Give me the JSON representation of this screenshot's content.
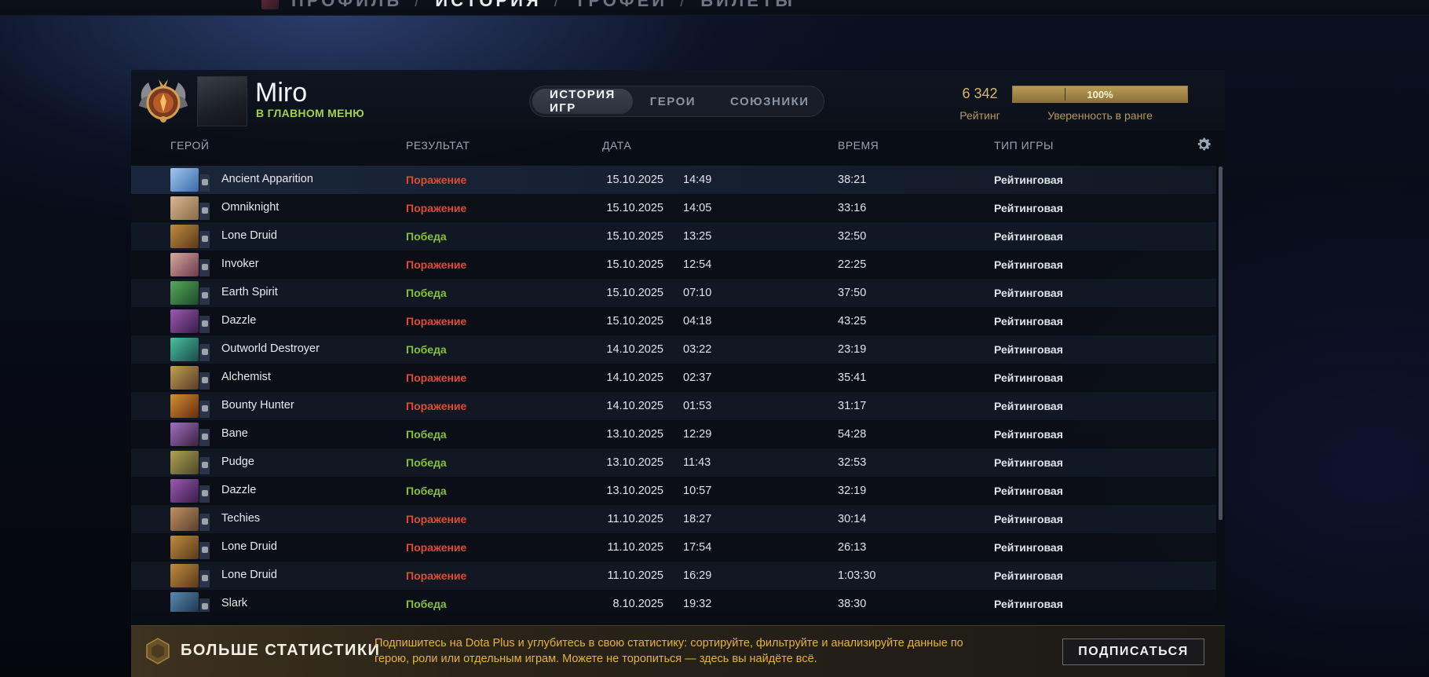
{
  "nav": {
    "items": [
      "ПРОФИЛЬ",
      "ИСТОРИЯ",
      "ТРОФЕИ",
      "БИЛЕТЫ"
    ],
    "separator": "/"
  },
  "player": {
    "name": "Miro",
    "status": "В ГЛАВНОМ МЕНЮ"
  },
  "tabs": [
    "ИСТОРИЯ ИГР",
    "ГЕРОИ",
    "СОЮЗНИКИ"
  ],
  "rating": {
    "value": "6 342",
    "label": "Рейтинг",
    "confidence_text": "100%",
    "confidence_fraction": 1.0,
    "confidence_label": "Уверенность в ранге"
  },
  "columns": {
    "hero": "ГЕРОЙ",
    "result": "РЕЗУЛЬТАТ",
    "date": "ДАТА",
    "duration": "ВРЕМЯ",
    "mode": "ТИП ИГРЫ"
  },
  "colors": {
    "loss": "#e04a35",
    "win": "#89bf3a",
    "status": "#a6d04a",
    "gold": "#d9b66a"
  },
  "matches": [
    {
      "hero": "Ancient Apparition",
      "result": "Поражение",
      "outcome": "loss",
      "date": "15.10.2025",
      "time": "14:49",
      "duration": "38:21",
      "mode": "Рейтинговая",
      "c1": "#9fc8f0",
      "c2": "#3a6aa8"
    },
    {
      "hero": "Omniknight",
      "result": "Поражение",
      "outcome": "loss",
      "date": "15.10.2025",
      "time": "14:05",
      "duration": "33:16",
      "mode": "Рейтинговая",
      "c1": "#d8b890",
      "c2": "#8a6a48"
    },
    {
      "hero": "Lone Druid",
      "result": "Победа",
      "outcome": "win",
      "date": "15.10.2025",
      "time": "13:25",
      "duration": "32:50",
      "mode": "Рейтинговая",
      "c1": "#c08a40",
      "c2": "#5a3a1a"
    },
    {
      "hero": "Invoker",
      "result": "Поражение",
      "outcome": "loss",
      "date": "15.10.2025",
      "time": "12:54",
      "duration": "22:25",
      "mode": "Рейтинговая",
      "c1": "#d8a8a0",
      "c2": "#6a3a4a"
    },
    {
      "hero": "Earth Spirit",
      "result": "Победа",
      "outcome": "win",
      "date": "15.10.2025",
      "time": "07:10",
      "duration": "37:50",
      "mode": "Рейтинговая",
      "c1": "#5aa85a",
      "c2": "#1a4a2a"
    },
    {
      "hero": "Dazzle",
      "result": "Поражение",
      "outcome": "loss",
      "date": "15.10.2025",
      "time": "04:18",
      "duration": "43:25",
      "mode": "Рейтинговая",
      "c1": "#9a5ab0",
      "c2": "#3a1a4a"
    },
    {
      "hero": "Outworld Destroyer",
      "result": "Победа",
      "outcome": "win",
      "date": "14.10.2025",
      "time": "03:22",
      "duration": "23:19",
      "mode": "Рейтинговая",
      "c1": "#4ac0a0",
      "c2": "#1a4a48"
    },
    {
      "hero": "Alchemist",
      "result": "Поражение",
      "outcome": "loss",
      "date": "14.10.2025",
      "time": "02:37",
      "duration": "35:41",
      "mode": "Рейтинговая",
      "c1": "#c0a050",
      "c2": "#5a3a2a"
    },
    {
      "hero": "Bounty Hunter",
      "result": "Поражение",
      "outcome": "loss",
      "date": "14.10.2025",
      "time": "01:53",
      "duration": "31:17",
      "mode": "Рейтинговая",
      "c1": "#d09030",
      "c2": "#6a2a10"
    },
    {
      "hero": "Bane",
      "result": "Победа",
      "outcome": "win",
      "date": "13.10.2025",
      "time": "12:29",
      "duration": "54:28",
      "mode": "Рейтинговая",
      "c1": "#a070c0",
      "c2": "#3a2040"
    },
    {
      "hero": "Pudge",
      "result": "Победа",
      "outcome": "win",
      "date": "13.10.2025",
      "time": "11:43",
      "duration": "32:53",
      "mode": "Рейтинговая",
      "c1": "#b0a050",
      "c2": "#4a4a2a"
    },
    {
      "hero": "Dazzle",
      "result": "Победа",
      "outcome": "win",
      "date": "13.10.2025",
      "time": "10:57",
      "duration": "32:19",
      "mode": "Рейтинговая",
      "c1": "#9a5ab0",
      "c2": "#3a1a4a"
    },
    {
      "hero": "Techies",
      "result": "Поражение",
      "outcome": "loss",
      "date": "11.10.2025",
      "time": "18:27",
      "duration": "30:14",
      "mode": "Рейтинговая",
      "c1": "#c09060",
      "c2": "#5a4030"
    },
    {
      "hero": "Lone Druid",
      "result": "Поражение",
      "outcome": "loss",
      "date": "11.10.2025",
      "time": "17:54",
      "duration": "26:13",
      "mode": "Рейтинговая",
      "c1": "#c08a40",
      "c2": "#5a3a1a"
    },
    {
      "hero": "Lone Druid",
      "result": "Поражение",
      "outcome": "loss",
      "date": "11.10.2025",
      "time": "16:29",
      "duration": "1:03:30",
      "mode": "Рейтинговая",
      "c1": "#c08a40",
      "c2": "#5a3a1a"
    },
    {
      "hero": "Slark",
      "result": "Победа",
      "outcome": "win",
      "date": "8.10.2025",
      "time": "19:32",
      "duration": "38:30",
      "mode": "Рейтинговая",
      "c1": "#5a8ab0",
      "c2": "#1a3048"
    }
  ],
  "banner": {
    "title": "БОЛЬШЕ СТАТИСТИКИ",
    "text": "Подпишитесь на Dota Plus и углубитесь в свою статистику: сортируйте, фильтруйте и анализируйте данные по герою, роли или отдельным играм. Можете не торопиться — здесь вы найдёте всё.",
    "button": "ПОДПИСАТЬСЯ"
  }
}
